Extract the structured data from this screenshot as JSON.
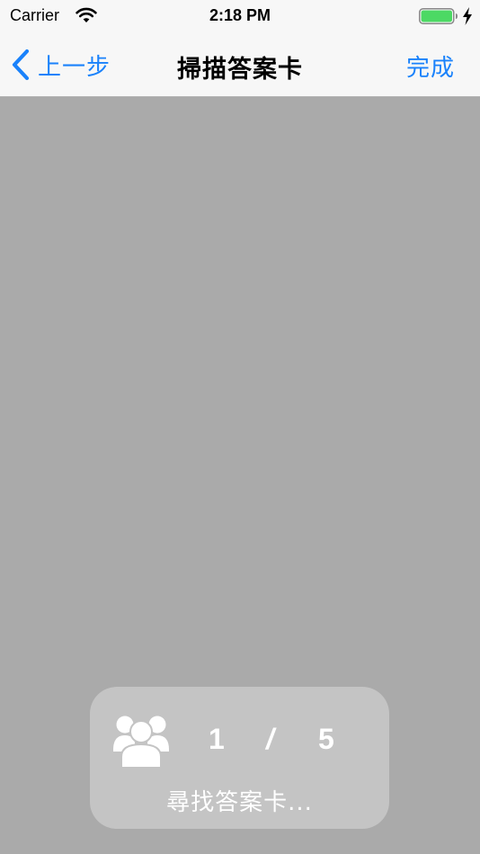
{
  "status_bar": {
    "carrier": "Carrier",
    "time": "2:18 PM",
    "battery_color": "#4cd964"
  },
  "nav": {
    "back_label": "上一步",
    "title": "掃描答案卡",
    "done_label": "完成",
    "accent_color": "#1a82fb"
  },
  "scan_panel": {
    "icon": "group-icon",
    "current": "1",
    "separator": "/",
    "total": "5",
    "status": "尋找答案卡..."
  }
}
